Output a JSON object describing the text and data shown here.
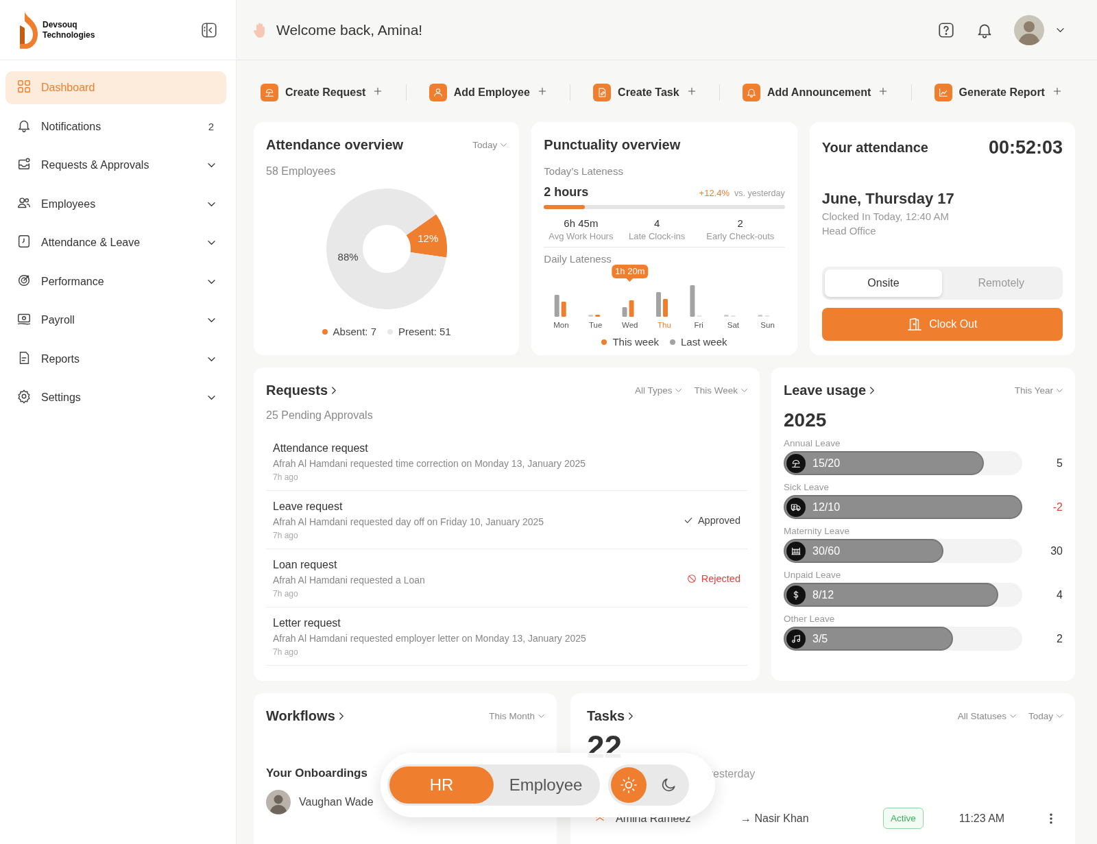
{
  "sidebar": {
    "brand": "Devsouq Technologies",
    "items": [
      {
        "label": "Dashboard",
        "kind": "link",
        "selected": true
      },
      {
        "label": "Notifications",
        "kind": "link",
        "selected": false,
        "badge": "2"
      },
      {
        "label": "Requests & Approvals",
        "kind": "group",
        "selected": false
      },
      {
        "label": "Employees",
        "kind": "group",
        "selected": false
      },
      {
        "label": "Attendance & Leave",
        "kind": "group",
        "selected": false
      },
      {
        "label": "Performance",
        "kind": "group",
        "selected": false
      },
      {
        "label": "Payroll",
        "kind": "group",
        "selected": false
      },
      {
        "label": "Reports",
        "kind": "group",
        "selected": false
      },
      {
        "label": "Settings",
        "kind": "group",
        "selected": false
      }
    ]
  },
  "header": {
    "greeting": "Welcome back, Amina!"
  },
  "quick_actions": [
    "Create Request",
    "Add Employee",
    "Create Task",
    "Add Announcement",
    "Generate Report"
  ],
  "attendance_overview": {
    "title": "Attendance overview",
    "filter": "Today",
    "subtitle": "58 Employees",
    "chart_data": {
      "type": "donut",
      "values": [
        12,
        88
      ],
      "value_labels": [
        "12%",
        "88%"
      ]
    },
    "legend": [
      {
        "label": "Absent: 7",
        "color": "#ef7f2f"
      },
      {
        "label": "Present: 51",
        "color": "#e8e8e8"
      }
    ]
  },
  "punctuality_overview": {
    "title": "Punctuality overview",
    "subtitle": "Today’s Lateness",
    "value": "2 hours",
    "change": "+12.4%",
    "change_note": "vs. yesterday",
    "level": 0.17,
    "stats": [
      {
        "value": "6h 45m",
        "label": "Avg Work Hours"
      },
      {
        "value": "4",
        "label": "Late Clock-ins"
      },
      {
        "value": "2",
        "label": "Early Check-outs"
      }
    ],
    "daily_title": "Daily Lateness",
    "days": [
      {
        "label": "Mon",
        "selected": false
      },
      {
        "label": "Tue",
        "selected": false
      },
      {
        "label": "Wed",
        "selected": false,
        "tooltip": "1h 20m"
      },
      {
        "label": "Thu",
        "selected": true
      },
      {
        "label": "Fri",
        "selected": false
      },
      {
        "label": "Sat",
        "selected": false
      },
      {
        "label": "Sun",
        "selected": false
      }
    ],
    "legend": [
      {
        "label": "This week",
        "color": "#ef7f2f"
      },
      {
        "label": "Last week",
        "color": "#a3a3a3"
      }
    ]
  },
  "your_attendance": {
    "title": "Your attendance",
    "timer": "00:52:03",
    "date": "June, Thursday 17",
    "clocked_in": "Clocked In Today, 12:40 AM",
    "location": "Head Office",
    "modes": [
      {
        "label": "Onsite",
        "selected": true
      },
      {
        "label": "Remotely",
        "selected": false
      }
    ],
    "action": "Clock Out"
  },
  "requests": {
    "title": "Requests",
    "filters": [
      "All Types",
      "This Week"
    ],
    "subtitle": "25 Pending Approvals",
    "items": [
      {
        "title": "Attendance request",
        "description": "Afrah Al Hamdani requested time correction on Monday 13, January 2025",
        "time": "7h ago"
      },
      {
        "title": "Leave request",
        "description": "Afrah Al Hamdani requested day off on Friday 10, January 2025",
        "time": "7h ago",
        "status": {
          "kind": "approved",
          "label": "Approved"
        }
      },
      {
        "title": "Loan request",
        "description": "Afrah Al Hamdani requested a Loan",
        "time": "7h ago",
        "status": {
          "kind": "rejected",
          "label": "Rejected"
        }
      },
      {
        "title": "Letter request",
        "description": "Afrah Al Hamdani requested employer letter on Monday 13, January 2025",
        "time": "7h ago"
      }
    ]
  },
  "leave_usage": {
    "title": "Leave usage",
    "filter": "This Year",
    "year": "2025",
    "items": [
      {
        "label": "Annual Leave",
        "usage": "15/20",
        "level": 0.84,
        "remaining": "5",
        "overdrawn": false
      },
      {
        "label": "Sick Leave",
        "usage": "12/10",
        "level": 1,
        "remaining": "-2",
        "overdrawn": true
      },
      {
        "label": "Maternity Leave",
        "usage": "30/60",
        "level": 0.67,
        "remaining": "30",
        "overdrawn": false
      },
      {
        "label": "Unpaid Leave",
        "usage": "8/12",
        "level": 0.9,
        "remaining": "4",
        "overdrawn": false
      },
      {
        "label": "Other Leave",
        "usage": "3/5",
        "level": 0.71,
        "remaining": "2",
        "overdrawn": false
      }
    ]
  },
  "workflows": {
    "title": "Workflows",
    "filter": "This Month",
    "section": "Your Onboardings",
    "people": [
      {
        "name": "Vaughan Wade"
      }
    ]
  },
  "tasks": {
    "title": "Tasks",
    "filters": [
      "All Statuses",
      "Today"
    ],
    "count": "22",
    "compare": "yesterday",
    "rows": [
      {
        "assignee": "Amina Rameez",
        "assigned_to": "→ Nasir Khan",
        "status": "Active",
        "time": "11:23 AM"
      }
    ]
  },
  "mode_switch": {
    "roles": [
      {
        "label": "HR",
        "selected": true
      },
      {
        "label": "Employee",
        "selected": false
      }
    ],
    "themes": [
      {
        "kind": "light",
        "selected": true
      },
      {
        "kind": "dark",
        "selected": false
      }
    ]
  }
}
